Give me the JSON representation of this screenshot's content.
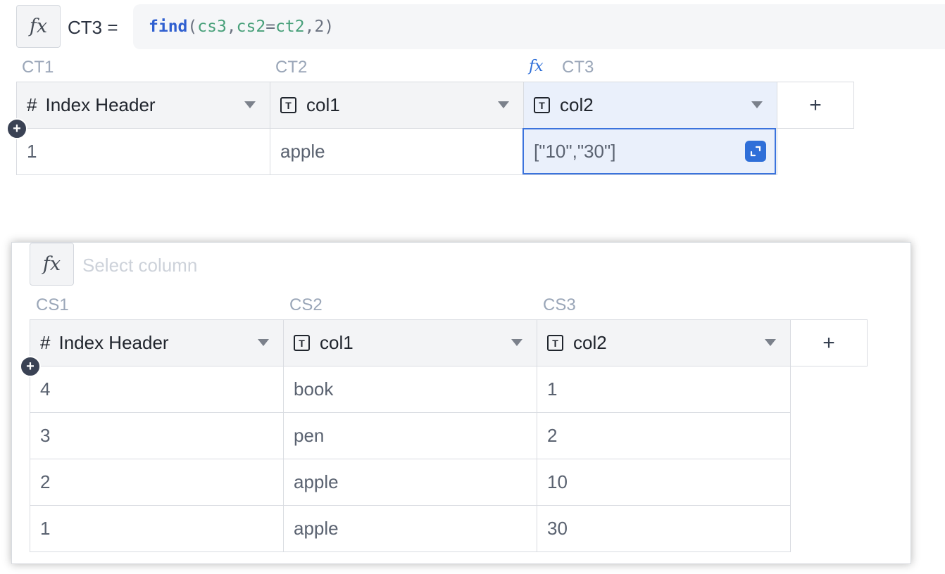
{
  "top": {
    "formula": {
      "fx_label": "fx",
      "target": "CT3 =",
      "fn": "find",
      "open_paren": "(",
      "arg1": "cs3",
      "comma1": ",",
      "arg2_left": "cs2",
      "eq": "=",
      "arg2_right": "ct2",
      "comma2": ",",
      "arg3": "2",
      "close_paren": ")"
    },
    "columns": [
      "CT1",
      "CT2",
      "CT3"
    ],
    "column3_fx": "fx",
    "headers": [
      "Index Header",
      "col1",
      "col2"
    ],
    "header_type_icons": [
      "#",
      "T",
      "T"
    ],
    "add_column_label": "+",
    "rows": [
      [
        "1",
        "apple",
        "[\"10\",\"30\"]"
      ]
    ],
    "selected_cell": "CT3 row 1"
  },
  "bottom": {
    "formula": {
      "fx_label": "fx",
      "placeholder": "Select column"
    },
    "columns": [
      "CS1",
      "CS2",
      "CS3"
    ],
    "headers": [
      "Index Header",
      "col1",
      "col2"
    ],
    "header_type_icons": [
      "#",
      "T",
      "T"
    ],
    "add_column_label": "+",
    "rows": [
      [
        "4",
        "book",
        "1"
      ],
      [
        "3",
        "pen",
        "2"
      ],
      [
        "2",
        "apple",
        "10"
      ],
      [
        "1",
        "apple",
        "30"
      ]
    ]
  },
  "colors": {
    "accent": "#2f6fd8",
    "function": "#2f5fd0",
    "reference": "#48a07a",
    "selected_bg": "#eaf0fb"
  }
}
